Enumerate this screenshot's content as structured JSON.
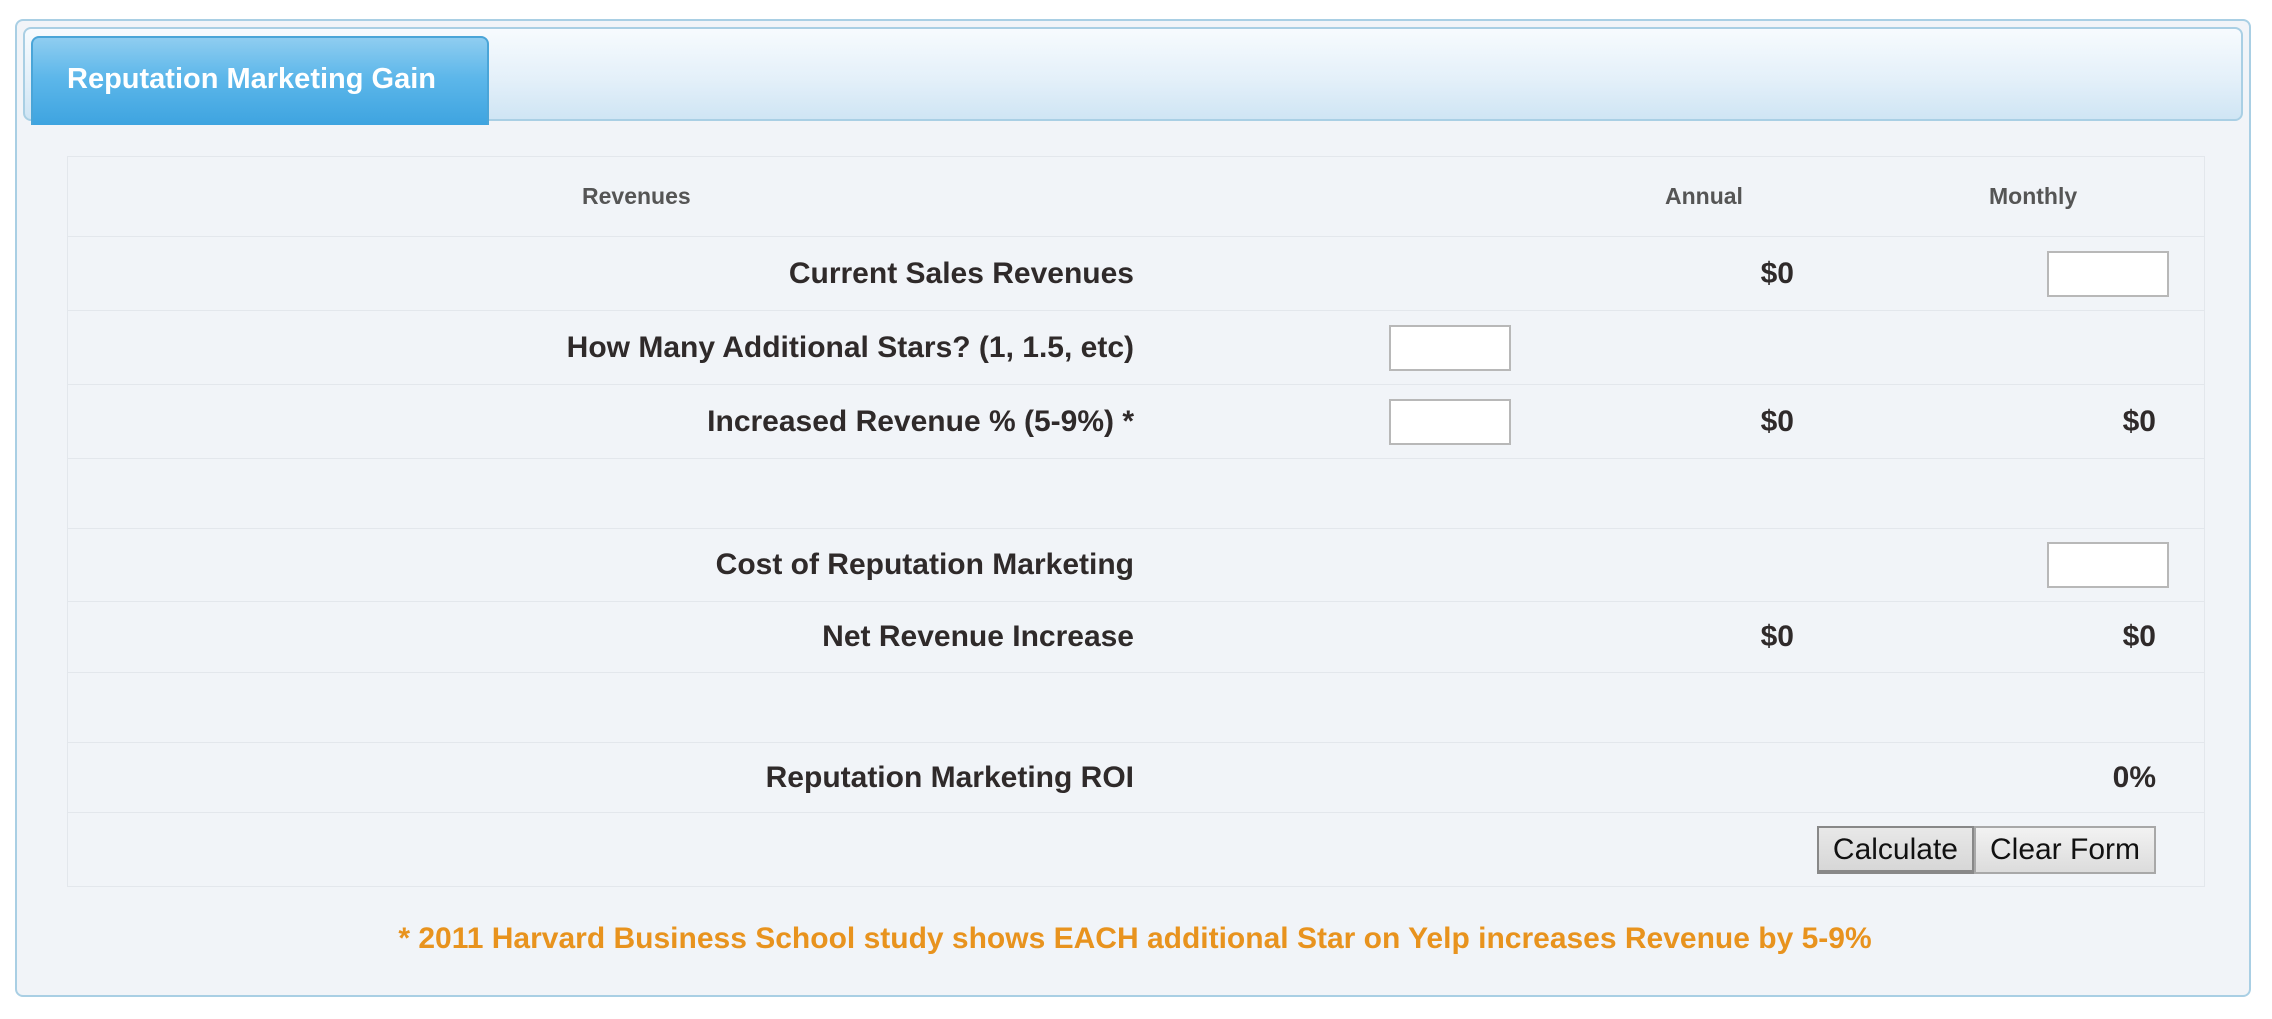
{
  "tab": {
    "label": "Reputation Marketing Gain"
  },
  "table": {
    "headers": {
      "revenues": "Revenues",
      "annual": "Annual",
      "monthly": "Monthly"
    },
    "current_sales": {
      "label": "Current Sales Revenues",
      "annual": "$0",
      "monthly_input": ""
    },
    "additional_stars": {
      "label": "How Many Additional Stars? (1, 1.5, etc)",
      "input": ""
    },
    "increased_revenue": {
      "label": "Increased Revenue % (5-9%) *",
      "input": "",
      "annual": "$0",
      "monthly": "$0"
    },
    "cost": {
      "label": "Cost of Reputation Marketing",
      "monthly_input": ""
    },
    "net_increase": {
      "label": "Net Revenue Increase",
      "annual": "$0",
      "monthly": "$0"
    },
    "roi": {
      "label": "Reputation Marketing ROI",
      "value": "0%"
    },
    "buttons": {
      "calculate": "Calculate",
      "clear": "Clear Form"
    }
  },
  "footnote": "* 2011 Harvard Business School study shows EACH additional Star on Yelp increases Revenue by 5-9%",
  "colors": {
    "tab_blue": "#4aa5d8",
    "footnote_orange": "#e8931e",
    "panel_bg": "#f1f4f8"
  }
}
